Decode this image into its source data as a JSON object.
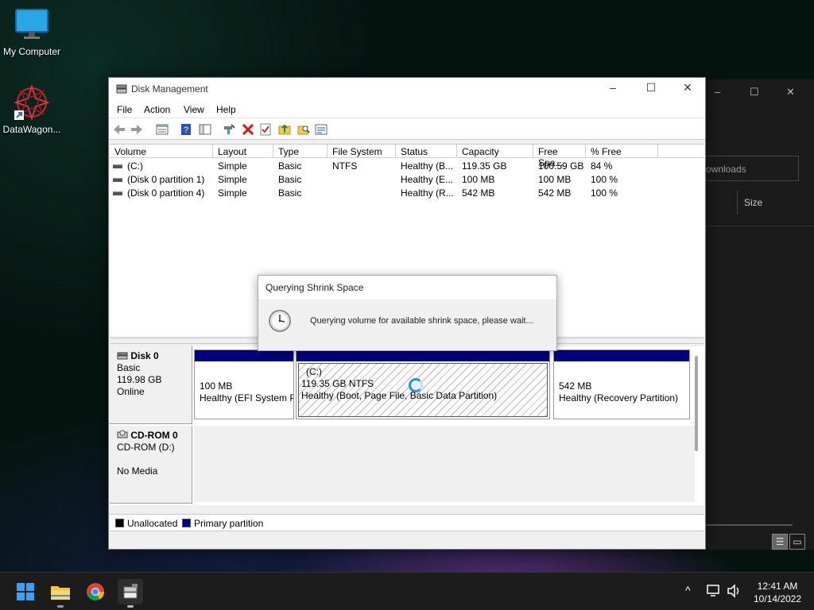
{
  "desktop": {
    "icons": [
      {
        "label": "My Computer"
      },
      {
        "label": "DataWagon..."
      }
    ]
  },
  "background_window": {
    "controls": [
      "–",
      "☐",
      "✕"
    ],
    "search_placeholder": "ownloads",
    "column_header": "Size"
  },
  "window": {
    "title": "Disk Management",
    "controls": {
      "minimize": "–",
      "maximize": "☐",
      "close": "✕"
    },
    "menu": [
      "File",
      "Action",
      "View",
      "Help"
    ],
    "toolbar_icons": [
      "back-arrow-icon",
      "forward-arrow-icon",
      "properties-list-icon",
      "help-icon",
      "console-tree-icon",
      "connect-icon",
      "delete-icon",
      "check-icon",
      "folder-up-icon",
      "folder-search-icon",
      "list-view-icon"
    ]
  },
  "volume_list": {
    "columns": [
      "Volume",
      "Layout",
      "Type",
      "File System",
      "Status",
      "Capacity",
      "Free Spa...",
      "% Free"
    ],
    "rows": [
      {
        "volume": "(C:)",
        "layout": "Simple",
        "type": "Basic",
        "fs": "NTFS",
        "status": "Healthy (B...",
        "capacity": "119.35 GB",
        "free": "100.59 GB",
        "pct": "84 %"
      },
      {
        "volume": "(Disk 0 partition 1)",
        "layout": "Simple",
        "type": "Basic",
        "fs": "",
        "status": "Healthy (E...",
        "capacity": "100 MB",
        "free": "100 MB",
        "pct": "100 %"
      },
      {
        "volume": "(Disk 0 partition 4)",
        "layout": "Simple",
        "type": "Basic",
        "fs": "",
        "status": "Healthy (R...",
        "capacity": "542 MB",
        "free": "542 MB",
        "pct": "100 %"
      }
    ]
  },
  "disks": [
    {
      "name": "Disk 0",
      "lines": [
        "Basic",
        "119.98 GB",
        "Online"
      ],
      "partitions": [
        {
          "label": "",
          "size": "100 MB",
          "status": "Healthy (EFI System P"
        },
        {
          "label": "(C:)",
          "size": "119.35 GB NTFS",
          "status": "Healthy (Boot, Page File, Basic Data Partition)"
        },
        {
          "label": "",
          "size": "542 MB",
          "status": "Healthy (Recovery Partition)"
        }
      ]
    },
    {
      "name": "CD-ROM 0",
      "lines": [
        "CD-ROM (D:)",
        "",
        "No Media"
      ]
    }
  ],
  "legend": [
    {
      "label": "Unallocated",
      "color": "#000000"
    },
    {
      "label": "Primary partition",
      "color": "#000080"
    }
  ],
  "dialog": {
    "title": "Querying Shrink Space",
    "message": "Querying volume for available shrink space, please wait..."
  },
  "taskbar": {
    "apps": [
      "windows-start-icon",
      "file-explorer-icon",
      "chrome-icon",
      "disk-management-icon"
    ],
    "tray_chevron": "^",
    "time": "12:41 AM",
    "date": "10/14/2022"
  }
}
